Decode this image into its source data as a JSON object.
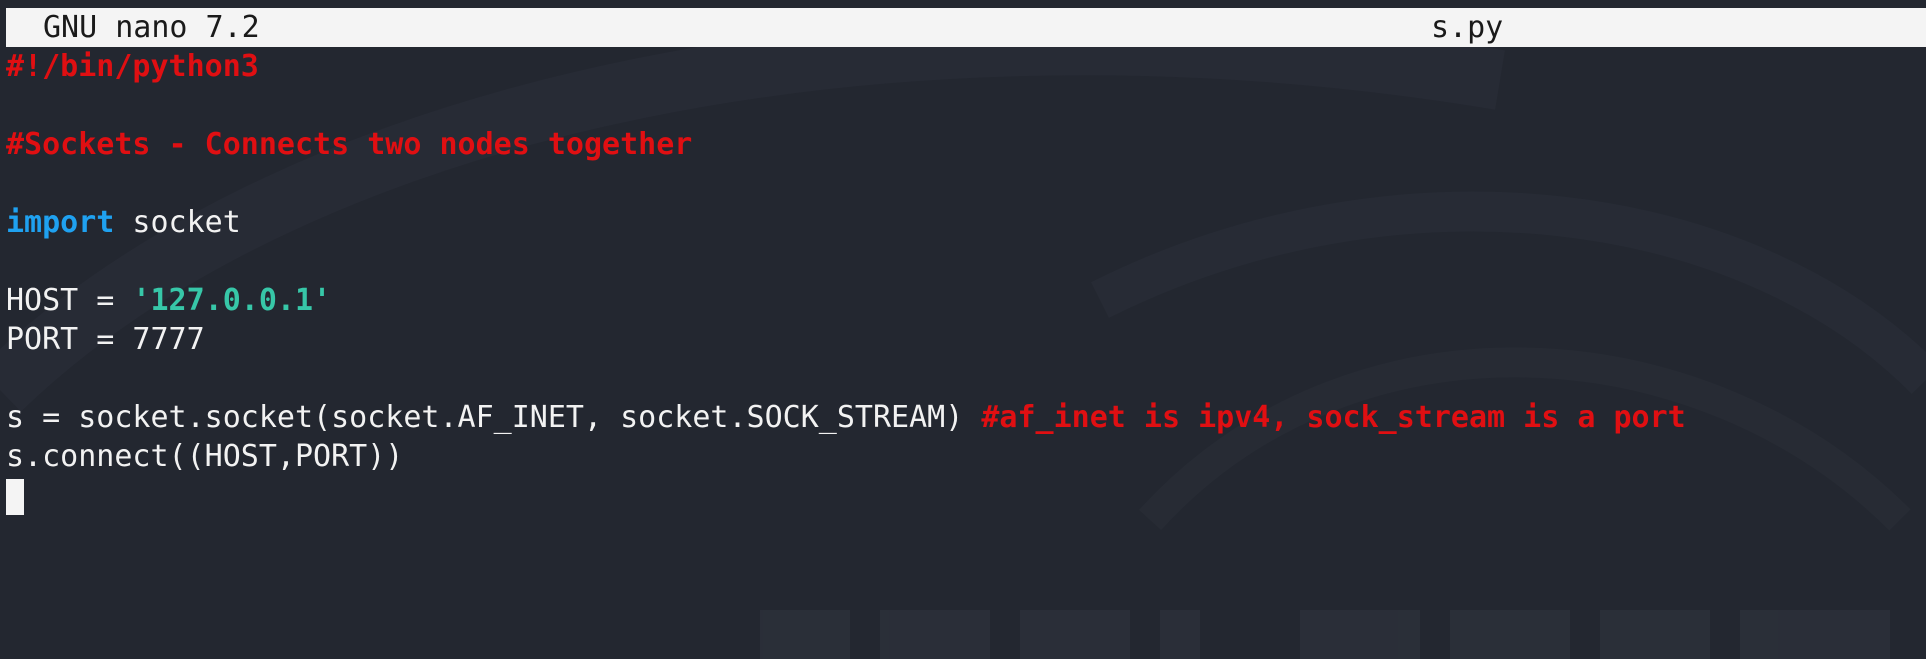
{
  "titlebar": {
    "app": "GNU nano 7.2",
    "file": "s.py"
  },
  "code": {
    "shebang": "#!/bin/python3",
    "comment_sockets": "#Sockets - Connects two nodes together",
    "import_kw": "import",
    "import_rest": " socket",
    "host_prefix": "HOST = ",
    "host_value": "'127.0.0.1'",
    "port_line": "PORT = 7777",
    "socket_call": "s = socket.socket(socket.AF_INET, socket.SOCK_STREAM) ",
    "socket_comment": "#af_inet is ipv4, sock_stream is a port",
    "connect_line": "s.connect((HOST,PORT))"
  },
  "colors": {
    "background": "#232730",
    "titlebar_bg": "#f4f4f4",
    "comment": "#e00f12",
    "keyword": "#1fa1f0",
    "string": "#37c7a8",
    "text": "#f2f2f2"
  }
}
